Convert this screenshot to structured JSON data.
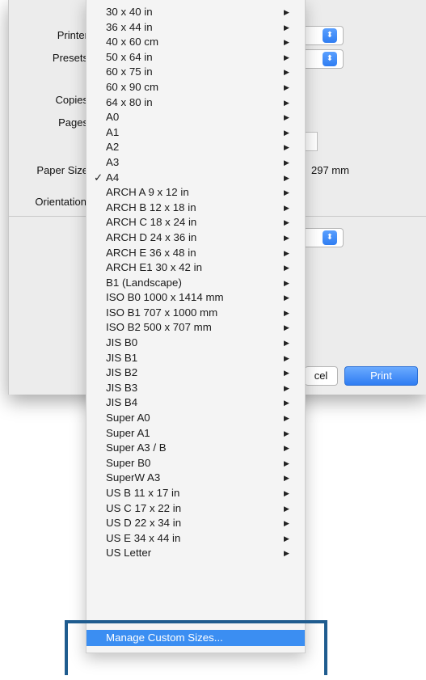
{
  "dialog": {
    "printer_label": "Printer",
    "presets_label": "Presets",
    "copies_label": "Copies",
    "pages_label": "Pages",
    "paper_size_label": "Paper Size",
    "paper_size_value": "297 mm",
    "orientation_label": "Orientation",
    "cancel_label": "cel",
    "print_label": "Print"
  },
  "menu": {
    "items": [
      {
        "label": "30 x 40 in",
        "checked": false
      },
      {
        "label": "36 x 44 in",
        "checked": false
      },
      {
        "label": "40 x 60 cm",
        "checked": false
      },
      {
        "label": "50 x 64 in",
        "checked": false
      },
      {
        "label": "60 x 75 in",
        "checked": false
      },
      {
        "label": "60 x 90 cm",
        "checked": false
      },
      {
        "label": "64 x 80 in",
        "checked": false
      },
      {
        "label": "A0",
        "checked": false
      },
      {
        "label": "A1",
        "checked": false
      },
      {
        "label": "A2",
        "checked": false
      },
      {
        "label": "A3",
        "checked": false
      },
      {
        "label": "A4",
        "checked": true
      },
      {
        "label": "ARCH A 9 x 12 in",
        "checked": false
      },
      {
        "label": "ARCH B 12 x 18 in",
        "checked": false
      },
      {
        "label": "ARCH C 18 x 24 in",
        "checked": false
      },
      {
        "label": "ARCH D 24 x 36 in",
        "checked": false
      },
      {
        "label": "ARCH E 36 x 48 in",
        "checked": false
      },
      {
        "label": "ARCH E1 30 x 42 in",
        "checked": false
      },
      {
        "label": "B1 (Landscape)",
        "checked": false
      },
      {
        "label": "ISO B0 1000 x 1414 mm",
        "checked": false
      },
      {
        "label": "ISO B1 707 x 1000 mm",
        "checked": false
      },
      {
        "label": "ISO B2 500 x 707 mm",
        "checked": false
      },
      {
        "label": "JIS B0",
        "checked": false
      },
      {
        "label": "JIS B1",
        "checked": false
      },
      {
        "label": "JIS B2",
        "checked": false
      },
      {
        "label": "JIS B3",
        "checked": false
      },
      {
        "label": "JIS B4",
        "checked": false
      },
      {
        "label": "Super A0",
        "checked": false
      },
      {
        "label": "Super A1",
        "checked": false
      },
      {
        "label": "Super A3 / B",
        "checked": false
      },
      {
        "label": "Super B0",
        "checked": false
      },
      {
        "label": "SuperW A3",
        "checked": false
      },
      {
        "label": "US B 11 x 17 in",
        "checked": false
      },
      {
        "label": "US C 17 x 22 in",
        "checked": false
      },
      {
        "label": "US D 22 x 34 in",
        "checked": false
      },
      {
        "label": "US E 34 x 44 in",
        "checked": false
      },
      {
        "label": "US Letter",
        "checked": false
      }
    ],
    "check_glyph": "✓",
    "submenu_glyph": "▶",
    "manage_label": "Manage Custom Sizes...",
    "selection_color": "#3b8ef2",
    "highlight_color": "#1f5c8f"
  }
}
